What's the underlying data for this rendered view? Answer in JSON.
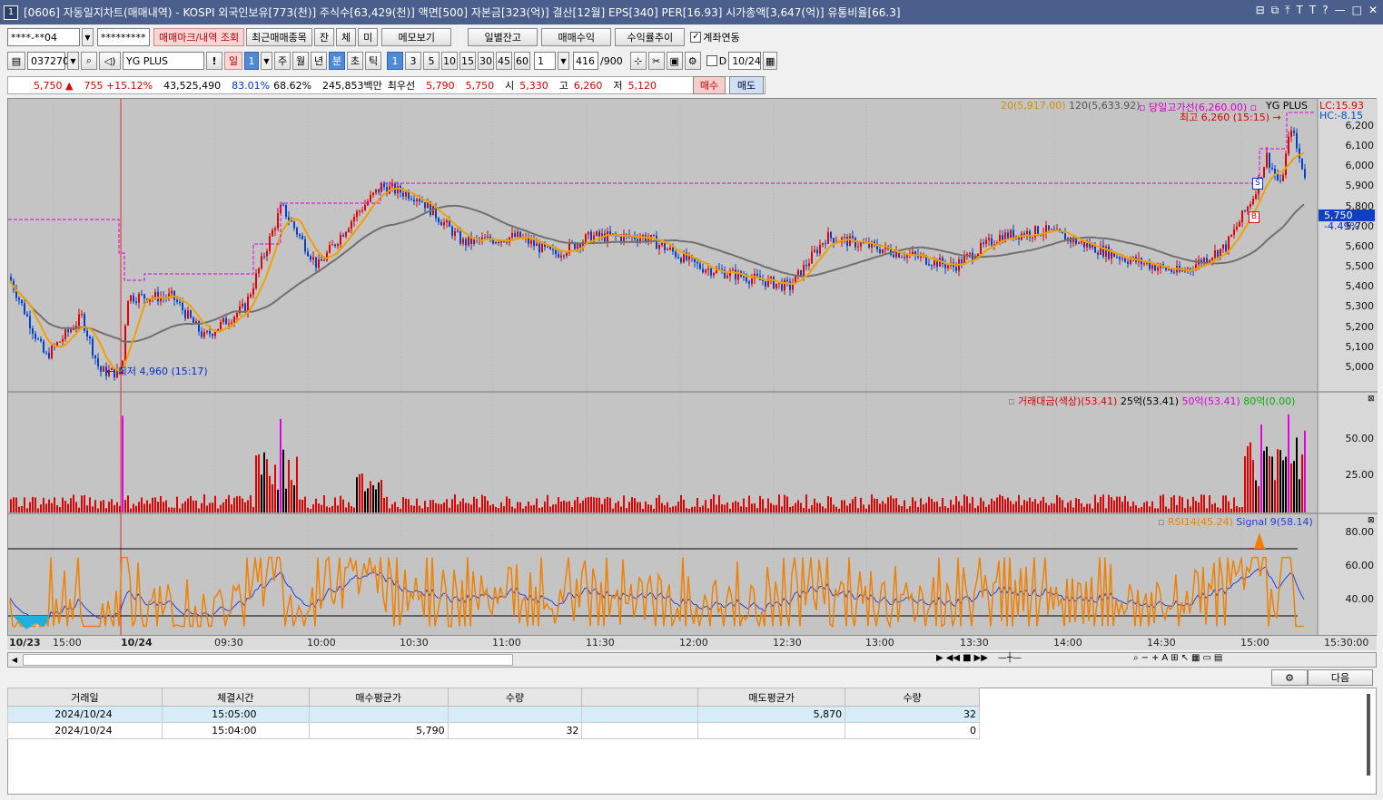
{
  "titlebar": {
    "icon": "1",
    "title": "[0606] 자동일지차트(매매내역) - KOSPI 외국인보유[773(천)] 주식수[63,429(천)] 액면[500] 자본금[323(억)] 결산[12월] EPS[340] PER[16.93] 시가총액[3,647(억)] 유통비율[66.3]",
    "buttons": [
      "⊟",
      "⧉",
      "⤒",
      "T",
      "T",
      "?",
      "—",
      "□",
      "✕"
    ]
  },
  "toolbar1": {
    "account": "****-**04",
    "password": "*********",
    "btn_trade_mark": "매매마크/내역 조회",
    "btn_recent": "최근매매종목",
    "btn_jan": "잔",
    "btn_che": "체",
    "btn_mi": "미",
    "btn_memo": "메모보기",
    "btn_daily": "일별잔고",
    "btn_profit": "매매수익",
    "btn_return": "수익률추이",
    "chk_link": "계좌연동"
  },
  "toolbar2": {
    "code": "037270",
    "name": "YG PLUS",
    "excl": "!",
    "periods": [
      "일",
      "1",
      "주",
      "월",
      "년",
      "분",
      "초",
      "틱"
    ],
    "intervals": [
      "1",
      "3",
      "5",
      "10",
      "15",
      "30",
      "45",
      "60"
    ],
    "count": "1",
    "range": "416",
    "range_total": "/900",
    "d_label": "D",
    "date": "10/24"
  },
  "quote": {
    "price": "5,750",
    "arrow": "▲",
    "change": "755",
    "change_pct": "+15.12%",
    "volume": "43,525,490",
    "ratio1": "83.01%",
    "ratio2": "68.62%",
    "amount": "245,853백만",
    "best_label": "최우선",
    "best_ask": "5,790",
    "best_bid": "5,750",
    "open_label": "시",
    "open": "5,330",
    "high_label": "고",
    "high": "6,260",
    "low_label": "저",
    "low": "5,120",
    "buy": "매수",
    "sell": "매도"
  },
  "price_panel": {
    "ma20": "20(5,917.00)",
    "ma120": "120(5,633.92)",
    "dayhigh": "당일고가선(6,260.00)",
    "symbol": "YG PLUS",
    "lc": "LC:15.93",
    "hc": "HC:-8.15",
    "high_note": "최고 6,260 (15:15)",
    "low_note": "최저 4,960 (15:17)",
    "cur_price": "5,750",
    "cur_pct": "-4.49%",
    "marker_s": "S",
    "marker_b": "B",
    "yticks": [
      "6,200",
      "6,100",
      "6,000",
      "5,900",
      "5,800",
      "5,700",
      "5,600",
      "5,500",
      "5,400",
      "5,300",
      "5,200",
      "5,100",
      "5,000"
    ]
  },
  "volume_panel": {
    "legend1": "거래대금(색상)(53.41)",
    "legend2": "25억(53.41)",
    "legend3": "50억(53.41)",
    "legend4": "80억(0.00)",
    "yticks": [
      "50.00",
      "25.00"
    ]
  },
  "rsi_panel": {
    "legend1": "RSI14(45.24)",
    "legend2": "Signal 9(58.14)",
    "yticks": [
      "80.00",
      "60.00",
      "40.00"
    ]
  },
  "xaxis": {
    "labels": [
      "10/23",
      "15:00",
      "10/24",
      "09:30",
      "10:00",
      "10:30",
      "11:00",
      "11:30",
      "12:00",
      "12:30",
      "13:00",
      "13:30",
      "14:00",
      "14:30",
      "15:00",
      "15:30:00"
    ]
  },
  "grid": {
    "next": "다음",
    "headers": [
      "거래일",
      "체결시간",
      "매수평균가",
      "수량",
      "",
      "매도평균가",
      "수량"
    ],
    "rows": [
      [
        "2024/10/24",
        "15:05:00",
        "",
        "",
        "",
        "5,870",
        "32"
      ],
      [
        "2024/10/24",
        "15:04:00",
        "5,790",
        "32",
        "",
        "",
        "0"
      ]
    ]
  },
  "colors": {
    "up": "#e00000",
    "down": "#0040d0",
    "ma20": "#f0a000",
    "ma120": "#707070",
    "dayhigh": "#d000d0",
    "rsi": "#f08000",
    "signal": "#2040e0"
  }
}
